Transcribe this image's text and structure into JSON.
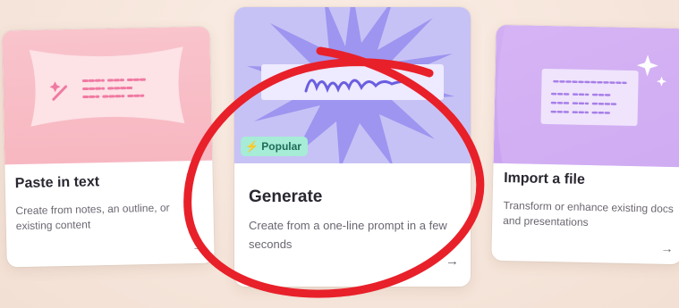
{
  "cards": {
    "paste": {
      "title": "Paste in text",
      "description": "Create from notes, an outline, or existing content",
      "arrow": "→"
    },
    "generate": {
      "badge": "Popular",
      "title": "Generate",
      "description": "Create from a one-line prompt in a few seconds",
      "arrow": "→"
    },
    "import": {
      "title": "Import a file",
      "description": "Transform or enhance existing docs and presentations",
      "arrow": "→"
    }
  },
  "colors": {
    "background": "#f6e6dc",
    "paste_art": "#f7b7c1",
    "generate_art": "#c7c2f5",
    "import_art": "#c69ef0",
    "badge_bg": "#a6ecd6",
    "annotation_red": "#e8202a"
  },
  "icons": [
    "magic-wand-icon",
    "lightning-icon",
    "sparkle-icon",
    "arrow-right-icon"
  ]
}
